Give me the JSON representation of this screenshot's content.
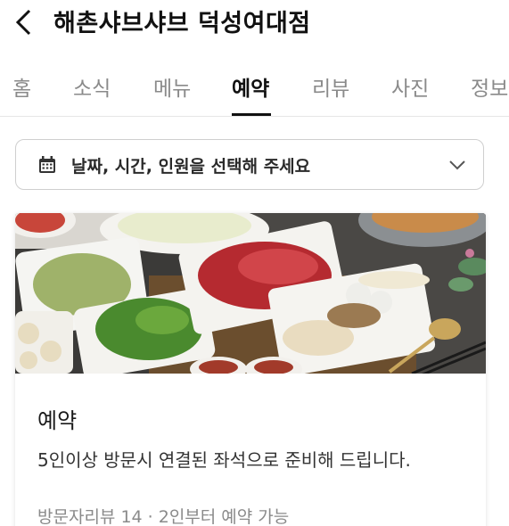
{
  "header": {
    "title": "해촌샤브샤브 덕성여대점"
  },
  "tabs": [
    {
      "label": "홈",
      "active": false
    },
    {
      "label": "소식",
      "active": false
    },
    {
      "label": "메뉴",
      "active": false
    },
    {
      "label": "예약",
      "active": true
    },
    {
      "label": "리뷰",
      "active": false
    },
    {
      "label": "사진",
      "active": false
    },
    {
      "label": "정보",
      "active": false
    }
  ],
  "date_select": {
    "label": "날짜, 시간, 인원을 선택해 주세요",
    "icon": "calendar-icon"
  },
  "card": {
    "title": "예약",
    "description": "5인이상 방문시 연결된 좌석으로 준비해 드립니다.",
    "meta": "방문자리뷰 14 · 2인부터 예약 가능"
  },
  "colors": {
    "accent": "#111111",
    "inactive_tab": "#8a8a8a",
    "border": "#cfcfcf"
  }
}
